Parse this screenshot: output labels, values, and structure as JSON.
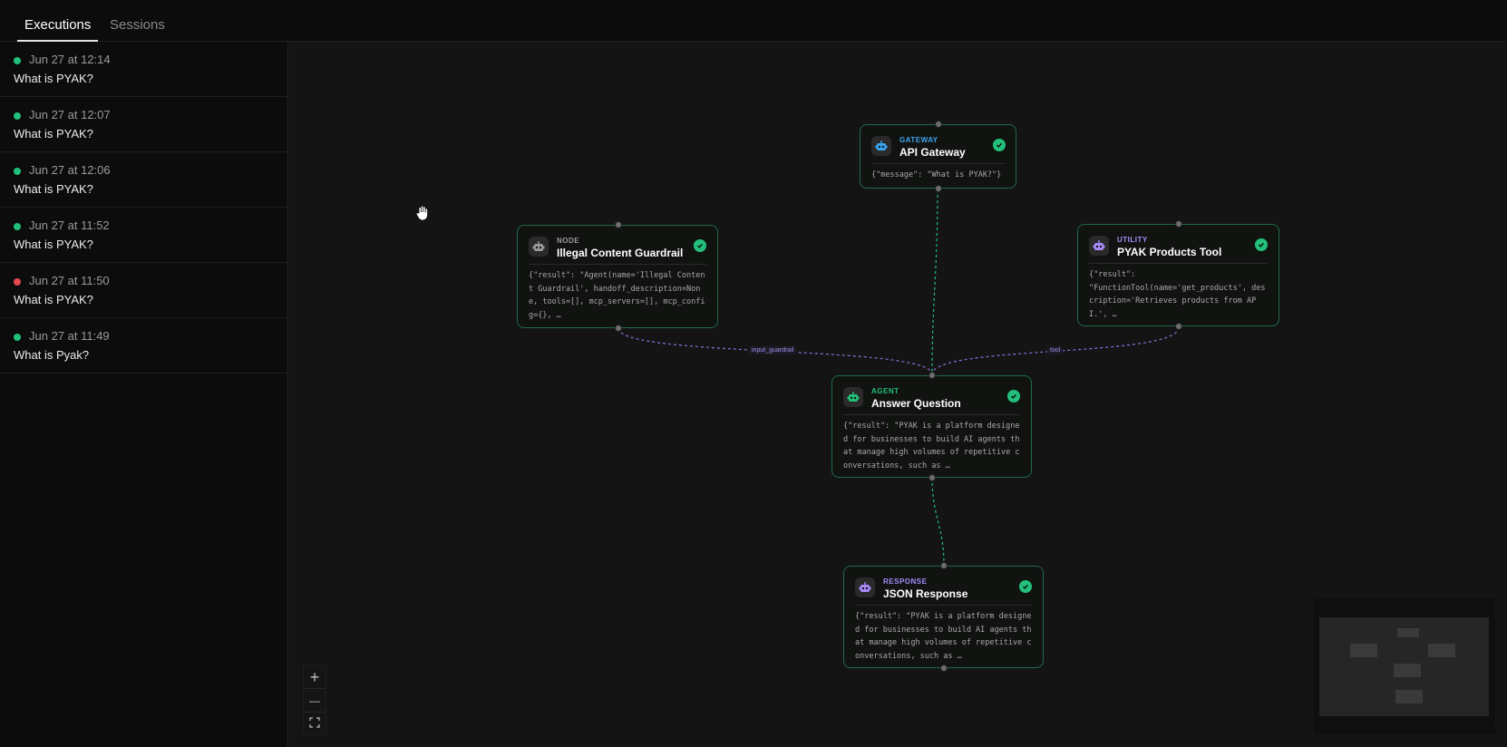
{
  "tabs": [
    {
      "label": "Executions",
      "active": true
    },
    {
      "label": "Sessions",
      "active": false
    }
  ],
  "executions": [
    {
      "time": "Jun 27 at 12:14",
      "title": "What is PYAK?",
      "status": "success",
      "status_color": "#22c07a"
    },
    {
      "time": "Jun 27 at 12:07",
      "title": "What is PYAK?",
      "status": "success",
      "status_color": "#22c07a"
    },
    {
      "time": "Jun 27 at 12:06",
      "title": "What is PYAK?",
      "status": "success",
      "status_color": "#22c07a"
    },
    {
      "time": "Jun 27 at 11:52",
      "title": "What is PYAK?",
      "status": "success",
      "status_color": "#22c07a"
    },
    {
      "time": "Jun 27 at 11:50",
      "title": "What is PYAK?",
      "status": "error",
      "status_color": "#e5484d"
    },
    {
      "time": "Jun 27 at 11:49",
      "title": "What is Pyak?",
      "status": "success",
      "status_color": "#22c07a"
    }
  ],
  "nodes": {
    "gateway": {
      "type": "GATEWAY",
      "name": "API Gateway",
      "body": "{\"message\": \"What is PYAK?\"}",
      "type_color": "#3ba5f0",
      "icon": "robot-icon",
      "status": "success"
    },
    "guardrail": {
      "type": "NODE",
      "name": "Illegal Content Guardrail",
      "body": "{\"result\": \"Agent(name='Illegal Content Guardrail', handoff_description=None, tools=[], mcp_servers=[], mcp_config={}, …",
      "type_color": "#9a9a9a",
      "icon": "robot-icon",
      "status": "success"
    },
    "utility": {
      "type": "UTILITY",
      "name": "PYAK Products Tool",
      "body": "{\"result\":\n\"FunctionTool(name='get_products', description='Retrieves products from API.', …",
      "type_color": "#a78bfa",
      "icon": "robot-icon",
      "status": "success"
    },
    "agent": {
      "type": "AGENT",
      "name": "Answer Question",
      "body": "{\"result\": \"PYAK is a platform designed for businesses to build AI agents that manage high volumes of repetitive conversations, such as …",
      "type_color": "#22c07a",
      "icon": "robot-icon",
      "status": "success"
    },
    "response": {
      "type": "RESPONSE",
      "name": "JSON Response",
      "body": "{\"result\": \"PYAK is a platform designed for businesses to build AI agents that manage high volumes of repetitive conversations, such as …",
      "type_color": "#a78bfa",
      "icon": "robot-icon",
      "status": "success"
    }
  },
  "edge_labels": {
    "guardrail": "input_guardrail",
    "tool": "tool"
  },
  "zoom_controls": {
    "zoom_in": "+",
    "zoom_out": "—",
    "fit_icon": "fit-view-icon"
  },
  "colors": {
    "success": "#22c07a",
    "error": "#e5484d",
    "node_border": "#1e6b4b",
    "edge_green": "#22c07a",
    "edge_purple": "#8b6fe0"
  }
}
